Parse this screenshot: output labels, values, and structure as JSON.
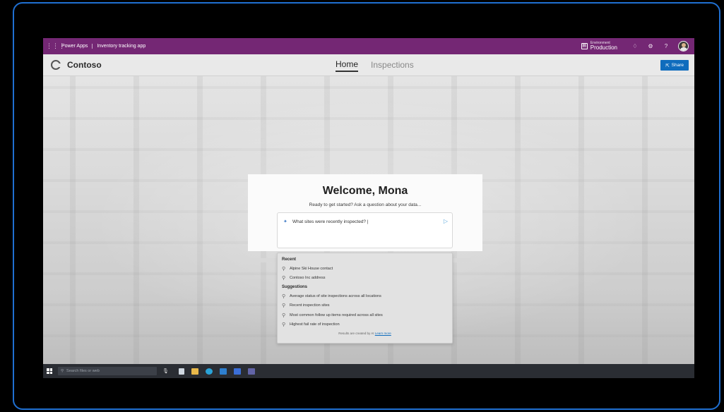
{
  "appbar": {
    "brand": "Power Apps",
    "app_name": "Inventory tracking app",
    "environment_label": "Environment",
    "environment_value": "Production",
    "icons": [
      "waffle-icon",
      "environment-icon",
      "notifications-icon",
      "settings-icon",
      "help-icon",
      "avatar"
    ]
  },
  "navbar": {
    "company": "Contoso",
    "tabs": [
      {
        "label": "Home",
        "active": true
      },
      {
        "label": "Inspections",
        "active": false
      }
    ],
    "share_label": "Share"
  },
  "welcome": {
    "title": "Welcome, Mona",
    "subtitle": "Ready to get started? Ask a question about your data...",
    "query": "What sites were recently inspected? |"
  },
  "dropdown": {
    "recent_title": "Recent",
    "recent": [
      {
        "label": "Alpine Ski House contact"
      },
      {
        "label": "Contoso Inc address"
      }
    ],
    "suggestions_title": "Suggestions",
    "suggestions": [
      {
        "label": "Average status of site inspections across all locations"
      },
      {
        "label": "Recent inspection sites"
      },
      {
        "label": "Most common follow up items required across all sites"
      },
      {
        "label": "Highest fail rate of inspection"
      }
    ],
    "footnote": "Results are created by AI",
    "learn_more": "Learn more"
  },
  "taskbar": {
    "search_placeholder": "Search files or web"
  },
  "colors": {
    "appbar": "#742774",
    "accent": "#0f6cbd",
    "frame_border": "#1f6fd1"
  }
}
